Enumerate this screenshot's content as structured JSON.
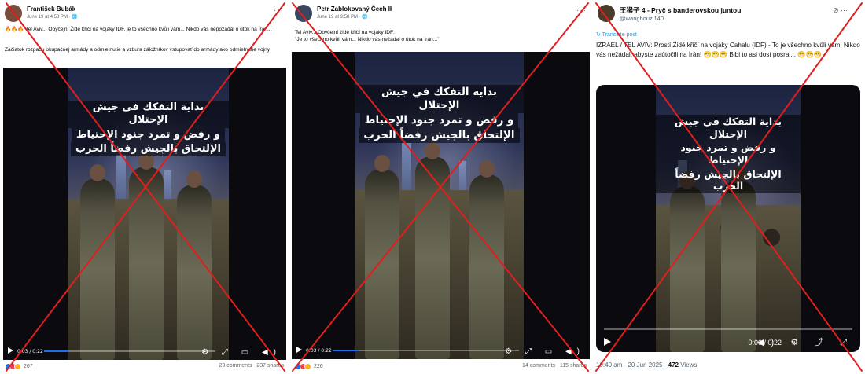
{
  "posts": [
    {
      "author": "František Bubák",
      "meta": "June 19 at 4:58 PM · 🌐",
      "line1": "🔥🔥🔥 Tel Aviv... Obyčejní Židé křičí na vojáky IDF, je to všechno kvůli vám... Nikdo vás nepožádal o útok na Írán...",
      "line2": "Začiatok rozpadu okupačnej armády a odmietnutie a vzbura záložníkov vstupovať do armády ako odmietnutie vojny",
      "caption": [
        "بداية التفكك في جيش الإحتلال",
        "و رفض و تمرد جنود الإحتياط",
        "الإلتحاق بالجيش رفضاً الحرب"
      ],
      "video_time": "0:03 / 0:22",
      "progress_fraction": 0.14,
      "reactions_count": "267",
      "comments": "23 comments",
      "shares": "237 shares",
      "ctl_icons": "⚙ ⤢ ▭ ◀)"
    },
    {
      "author": "Petr Zablokovaný Čech II",
      "meta": "June 19 at 9:58 PM · 🌐",
      "line1": "Tel Aviv... Obyčejní židé křičí na vojáky IDF:",
      "line2": "\"Je to všechno kvůli vám... Nikdo vás nežádal o útok na Írán...\"",
      "caption": [
        "بداية التفكك في جيش الإحتلال",
        "و رفض و تمرد جنود الإحتياط",
        "الإلتحاق بالجيش رفضاً الحرب"
      ],
      "video_time": "0:03 / 0:22",
      "progress_fraction": 0.14,
      "reactions_count": "226",
      "comments": "14 comments",
      "shares": "115 shares",
      "ctl_icons": "⚙ ⤢ ▭ ◀)"
    }
  ],
  "x_post": {
    "author": "王猴子 4 - Pryč s banderovskou juntou",
    "handle": "@wanghouzi140",
    "grok_icon": "⊘ ···",
    "translate": "↻ Translate post",
    "text": "IZRAEL / TEL AVIV: Prostí Židé křičí na vojáky Cahalu (IDF) - To je všechno kvůli vám! Nikdo vás nežádal, abyste zaútočili na Írán! 😁😁😁 Bibi to asi dost posral... 😁😁😁",
    "caption": [
      "بداية التفكك في جيش الإحتلال",
      "و رفض و تمرد جنود الإحتياط",
      "الإلتحاق بالجيش رفضاً الحرب"
    ],
    "video_time": "0:00 / 0:22",
    "ctl_icons": "◀) ⚙ ⤴ ⤢",
    "footer_time": "10:40 am · 20 Jun 2025 · ",
    "views_count": "472",
    "views_label": " Views"
  },
  "colors": {
    "cross": "#e01e1e",
    "facebook_blue": "#1b74e4",
    "x_blue": "#1d9bf0"
  },
  "icons": {
    "menu": "···"
  }
}
